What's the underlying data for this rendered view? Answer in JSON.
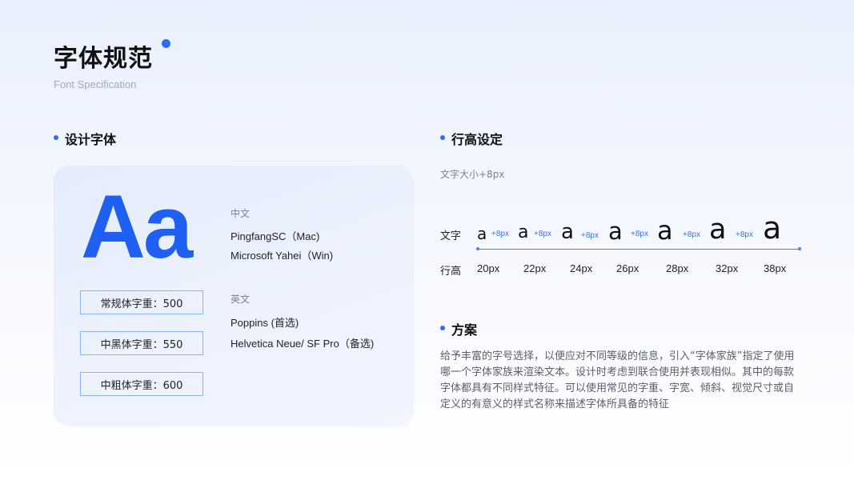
{
  "header": {
    "title": "字体规范",
    "subtitle": "Font Specification"
  },
  "colors": {
    "accent": "#2f6bf5",
    "sample_text": "#1f5ff2",
    "box_border": "#8fb2f5"
  },
  "design_fonts": {
    "section_title": "设计字体",
    "sample": "Aa",
    "weights": [
      "常规体字重：500",
      "中黑体字重：550",
      "中粗体字重：600"
    ],
    "chinese": {
      "label": "中文",
      "fonts": [
        "PingfangSC（Mac)",
        "Microsoft Yahei（Win)"
      ]
    },
    "english": {
      "label": "英文",
      "fonts": [
        "Poppins (首选)",
        "Helvetica Neue/ SF Pro（备选)"
      ]
    }
  },
  "line_height": {
    "section_title": "行高设定",
    "hint": "文字大小+8px",
    "row_text_label": "文字",
    "row_lh_label": "行高",
    "glyph": "a",
    "increment_label": "+8px",
    "values": [
      "20px",
      "22px",
      "24px",
      "26px",
      "28px",
      "32px",
      "38px"
    ]
  },
  "plan": {
    "section_title": "方案",
    "description": "给予丰富的字号选择，以便应对不同等级的信息，引入“字体家族”指定了使用哪一个字体家族来渲染文本。设计时考虑到联合使用并表现相似。其中的每款字体都具有不同样式特征。可以使用常见的字重、字宽、倾斜、视觉尺寸或自定义的有意义的样式名称来描述字体所具备的特征"
  }
}
